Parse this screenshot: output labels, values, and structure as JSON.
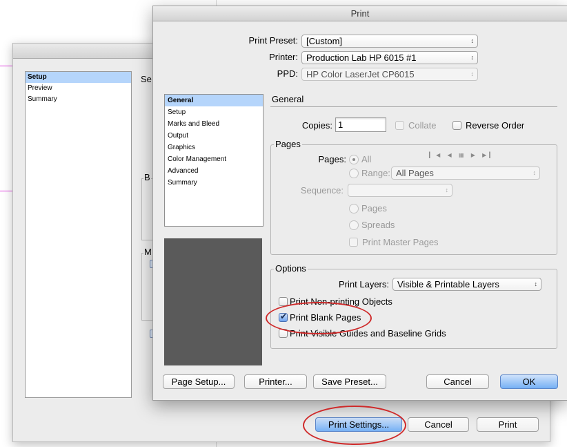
{
  "back_dialog": {
    "sections": [
      {
        "label": "Setup",
        "selected": true
      },
      {
        "label": "Preview",
        "selected": false
      },
      {
        "label": "Summary",
        "selected": false
      }
    ],
    "heading_partial": "Se",
    "group_b_label": "B",
    "group_m_label": "M",
    "buttons": {
      "print_settings": "Print Settings...",
      "cancel": "Cancel",
      "print": "Print"
    }
  },
  "print_dialog": {
    "title": "Print",
    "print_preset_label": "Print Preset:",
    "print_preset_value": "[Custom]",
    "printer_label": "Printer:",
    "printer_value": "Production Lab HP 6015 #1",
    "ppd_label": "PPD:",
    "ppd_value": "HP Color LaserJet CP6015",
    "sections": [
      {
        "label": "General",
        "selected": true
      },
      {
        "label": "Setup",
        "selected": false
      },
      {
        "label": "Marks and Bleed",
        "selected": false
      },
      {
        "label": "Output",
        "selected": false
      },
      {
        "label": "Graphics",
        "selected": false
      },
      {
        "label": "Color Management",
        "selected": false
      },
      {
        "label": "Advanced",
        "selected": false
      },
      {
        "label": "Summary",
        "selected": false
      }
    ],
    "panel_title": "General",
    "copies_label": "Copies:",
    "copies_value": "1",
    "collate_label": "Collate",
    "reverse_order_label": "Reverse Order",
    "pages_group": {
      "title": "Pages",
      "pages_label": "Pages:",
      "all_label": "All",
      "range_label": "Range:",
      "range_value": "All Pages",
      "sequence_label": "Sequence:",
      "sequence_value": "",
      "pages_option": "Pages",
      "spreads_option": "Spreads",
      "print_master_pages": "Print Master Pages",
      "nav_icons": [
        "first-page-icon",
        "prev-page-icon",
        "page-spread-icon",
        "next-page-icon",
        "last-page-icon"
      ]
    },
    "options_group": {
      "title": "Options",
      "print_layers_label": "Print Layers:",
      "print_layers_value": "Visible & Printable Layers",
      "print_nonprinting": {
        "label": "Print Non-printing Objects",
        "checked": false
      },
      "print_blank_pages": {
        "label": "Print Blank Pages",
        "checked": true
      },
      "print_guides": {
        "label": "Print Visible Guides and Baseline Grids",
        "checked": false
      }
    },
    "buttons": {
      "page_setup": "Page Setup...",
      "printer": "Printer...",
      "save_preset": "Save Preset...",
      "cancel": "Cancel",
      "ok": "OK"
    }
  },
  "colors": {
    "selection": "#b5d5fb",
    "default_button": "#76b0f4",
    "annotation": "#cf2a2a"
  }
}
